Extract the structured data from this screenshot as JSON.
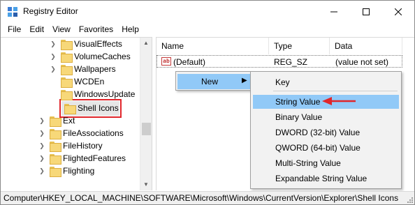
{
  "window": {
    "title": "Registry Editor",
    "icons": {
      "app": "registry-editor-icon",
      "minimize": "minimize-icon",
      "maximize": "maximize-icon",
      "close": "close-icon"
    }
  },
  "menu": [
    "File",
    "Edit",
    "View",
    "Favorites",
    "Help"
  ],
  "tree": {
    "items": [
      {
        "label": "VisualEffects",
        "expandable": true
      },
      {
        "label": "VolumeCaches",
        "expandable": true
      },
      {
        "label": "Wallpapers",
        "expandable": true
      },
      {
        "label": "WCDEn",
        "expandable": false
      },
      {
        "label": "WindowsUpdate",
        "expandable": false
      },
      {
        "label": "Shell Icons",
        "expandable": false,
        "selected": true
      },
      {
        "label": "Ext",
        "expandable": true
      },
      {
        "label": "FileAssociations",
        "expandable": true
      },
      {
        "label": "FileHistory",
        "expandable": true
      },
      {
        "label": "FlightedFeatures",
        "expandable": true
      },
      {
        "label": "Flighting",
        "expandable": true
      }
    ]
  },
  "list": {
    "columns": [
      "Name",
      "Type",
      "Data"
    ],
    "rows": [
      {
        "name": "(Default)",
        "type": "REG_SZ",
        "data": "(value not set)",
        "icon": "string-value-icon"
      }
    ]
  },
  "context_menu": {
    "new_label": "New",
    "submenu": [
      "Key",
      "String Value",
      "Binary Value",
      "DWORD (32-bit) Value",
      "QWORD (64-bit) Value",
      "Multi-String Value",
      "Expandable String Value"
    ],
    "highlighted": "String Value"
  },
  "status": {
    "path": "Computer\\HKEY_LOCAL_MACHINE\\SOFTWARE\\Microsoft\\Windows\\CurrentVersion\\Explorer\\Shell Icons"
  },
  "colors": {
    "highlight": "#91c9f7",
    "annotation_red": "#e0262b",
    "folder_yellow": "#f7d879"
  }
}
